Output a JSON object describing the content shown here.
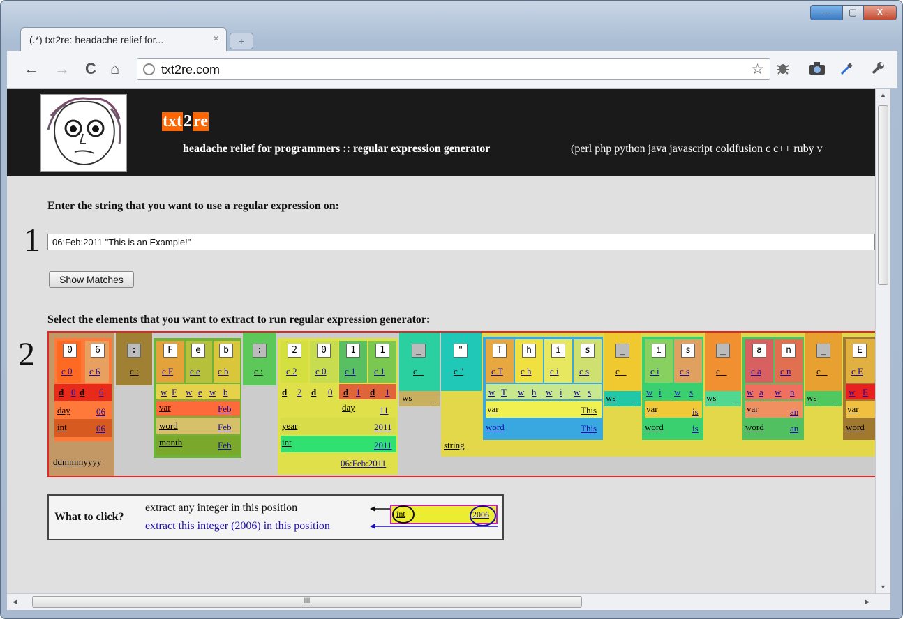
{
  "browser": {
    "tab_title": "(.*) txt2re: headache relief for...",
    "tab_close": "×",
    "newtab": "+",
    "url": "txt2re.com",
    "win_min": "—",
    "win_max": "▢",
    "win_close": "X",
    "back": "←",
    "forward": "→",
    "reload": "C",
    "home": "⌂",
    "star": "☆",
    "hscroll_grip": "III"
  },
  "header": {
    "brand_a": "txt",
    "brand_b": "2",
    "brand_c": "re",
    "tagline": "headache relief for programmers :: regular expression generator",
    "langs": "(perl php python java javascript coldfusion c c++ ruby v"
  },
  "step1": {
    "num": "1",
    "label": "Enter the string that you want to use a regular expression on:",
    "input_value": "06:Feb:2011 \"This is an Example!\"",
    "button": "Show Matches"
  },
  "step2": {
    "num": "2",
    "label": "Select the elements that you want to extract to run regular expression generator:"
  },
  "matches": {
    "chars": [
      "0",
      "6",
      ":",
      "F",
      "e",
      "b",
      ":",
      "2",
      "0",
      "1",
      "1",
      "_",
      "\"",
      "T",
      "h",
      "i",
      "s",
      "_",
      "i",
      "s",
      "_",
      "a",
      "n",
      "_",
      "E"
    ],
    "c_labels": [
      "c 0",
      "c 6",
      "c :",
      "c F",
      "c e",
      "c b",
      "c :",
      "c 2",
      "c 0",
      "c 1",
      "c 1",
      "c _",
      "c \"",
      "c T",
      "c h",
      "c i",
      "c s",
      "c _",
      "c i",
      "c s",
      "c _",
      "c a",
      "c n",
      "c _",
      "c E"
    ],
    "d_labels": [
      "d",
      "0",
      "d",
      "6",
      "d",
      "2",
      "d",
      "0",
      "d",
      "1",
      "d",
      "1"
    ],
    "w_labels": [
      "w",
      "F",
      "w",
      "e",
      "w",
      "b",
      "w",
      "T",
      "w",
      "h",
      "w",
      "i",
      "w",
      "s",
      "w",
      "i",
      "w",
      "s",
      "w",
      "a",
      "w",
      "n",
      "w",
      "E"
    ],
    "ws": "ws",
    "underscore": "_",
    "day": "day",
    "day_val": "06",
    "int": "int",
    "int_val": "06",
    "var": "var",
    "var_val": "Feb",
    "word": "word",
    "word_val": "Feb",
    "month": "month",
    "month_val": "Feb",
    "day2": "day",
    "day2_val": "11",
    "year": "year",
    "year_val": "2011",
    "int2": "int",
    "int2_val": "2011",
    "date": "ddmmmyyyy",
    "date_val": "06:Feb:2011",
    "string": "string",
    "var_this": "var",
    "var_this_val": "This",
    "word_this": "word",
    "word_this_val": "This",
    "var_is": "var",
    "var_is_val": "is",
    "word_is": "word",
    "word_is_val": "is",
    "var_an": "var",
    "var_an_val": "an",
    "word_an": "word",
    "word_an_val": "an",
    "var_e": "var",
    "word_e": "word"
  },
  "legend": {
    "question": "What to click?",
    "line1": "extract any integer in this position",
    "line2": "extract this integer (2006) in this position",
    "int": "int",
    "val": "2006"
  }
}
